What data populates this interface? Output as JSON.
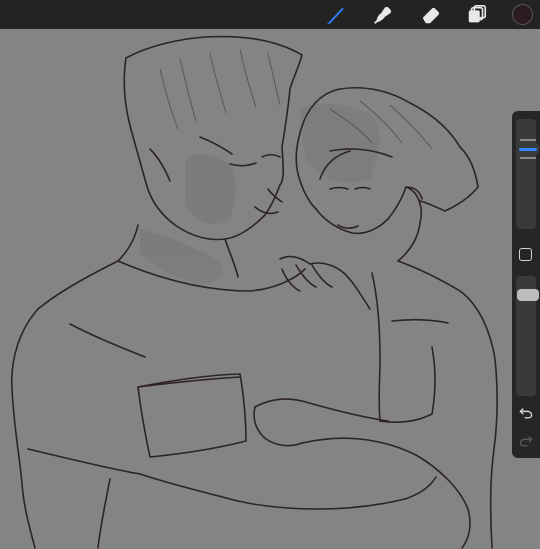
{
  "toolbar": {
    "tools": [
      {
        "name": "brush-tool",
        "icon": "brush-icon",
        "active": true,
        "color": "#2f7cf6"
      },
      {
        "name": "smudge-tool",
        "icon": "smudge-icon",
        "active": false,
        "color": "#e8e8e8"
      },
      {
        "name": "eraser-tool",
        "icon": "eraser-icon",
        "active": false,
        "color": "#e8e8e8"
      },
      {
        "name": "layers-tool",
        "icon": "layers-icon",
        "active": false,
        "color": "#e8e8e8"
      }
    ],
    "current_color": "#2a1c1f"
  },
  "sidebar": {
    "brush_size_level": 0.24,
    "opacity_level": 0.12,
    "undo_icon": "undo-icon",
    "redo_icon": "redo-icon",
    "modify_icon": "modify-square-icon"
  },
  "colors": {
    "background": "#848484",
    "toolbar_bg": "#232323",
    "sidebar_bg": "#262626",
    "sketch_line": "#2e2326",
    "accent": "#2f86ff"
  }
}
